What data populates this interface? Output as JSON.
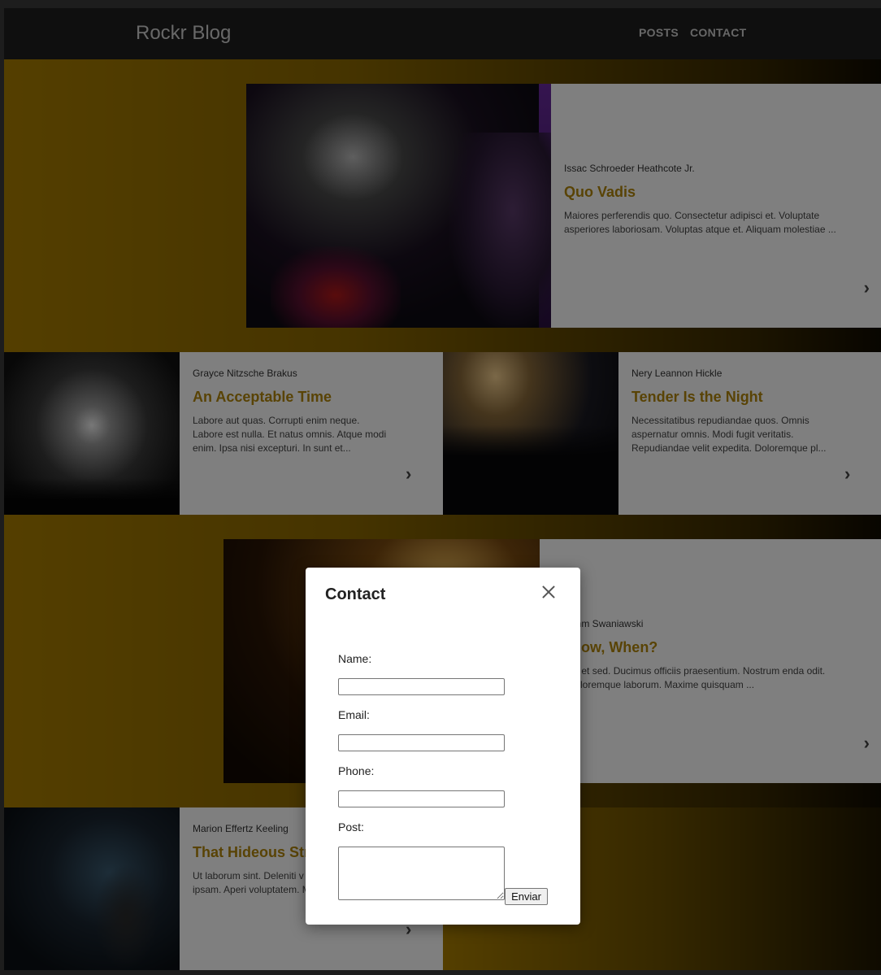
{
  "header": {
    "brand": "Rockr Blog",
    "nav": {
      "posts": "POSTS",
      "contact": "CONTACT"
    }
  },
  "posts": [
    {
      "author": "Issac Schroeder Heathcote Jr.",
      "title": "Quo Vadis",
      "excerpt": "Maiores perferendis quo. Consectetur adipisci et. Voluptate asperiores laboriosam. Voluptas atque et. Aliquam molestiae ..."
    },
    {
      "author": "Grayce Nitzsche Brakus",
      "title": "An Acceptable Time",
      "excerpt": "Labore aut quas. Corrupti enim neque. Labore est nulla. Et natus omnis. Atque modi enim. Ipsa nisi excepturi. In sunt et..."
    },
    {
      "author": "Nery Leannon Hickle",
      "title": "Tender Is the Night",
      "excerpt": "Necessitatibus repudiandae quos. Omnis aspernatur omnis. Modi fugit veritatis. Repudiandae velit expedita. Doloremque pl..."
    },
    {
      "author": "r Boehm Swaniawski",
      "title": "ot Now, When?",
      "excerpt": "atibus et sed. Ducimus officiis praesentium. Nostrum enda odit. Hic doloremque laborum. Maxime quisquam ..."
    },
    {
      "author": "Marion Effertz Keeling",
      "title": "That Hideous Str",
      "excerpt": "Ut laborum sint. Deleniti v doloremque ipsam. Aperi voluptatem. Maiores impe"
    }
  ],
  "icons": {
    "chevron": "›",
    "close": "close-icon"
  },
  "modal": {
    "title": "Contact",
    "fields": {
      "name": "Name:",
      "email": "Email:",
      "phone": "Phone:",
      "post": "Post:"
    },
    "submit": "Enviar"
  },
  "colors": {
    "accent": "#b3870a",
    "header_bg": "#1e1e1e",
    "band_start": "#a97e00"
  }
}
